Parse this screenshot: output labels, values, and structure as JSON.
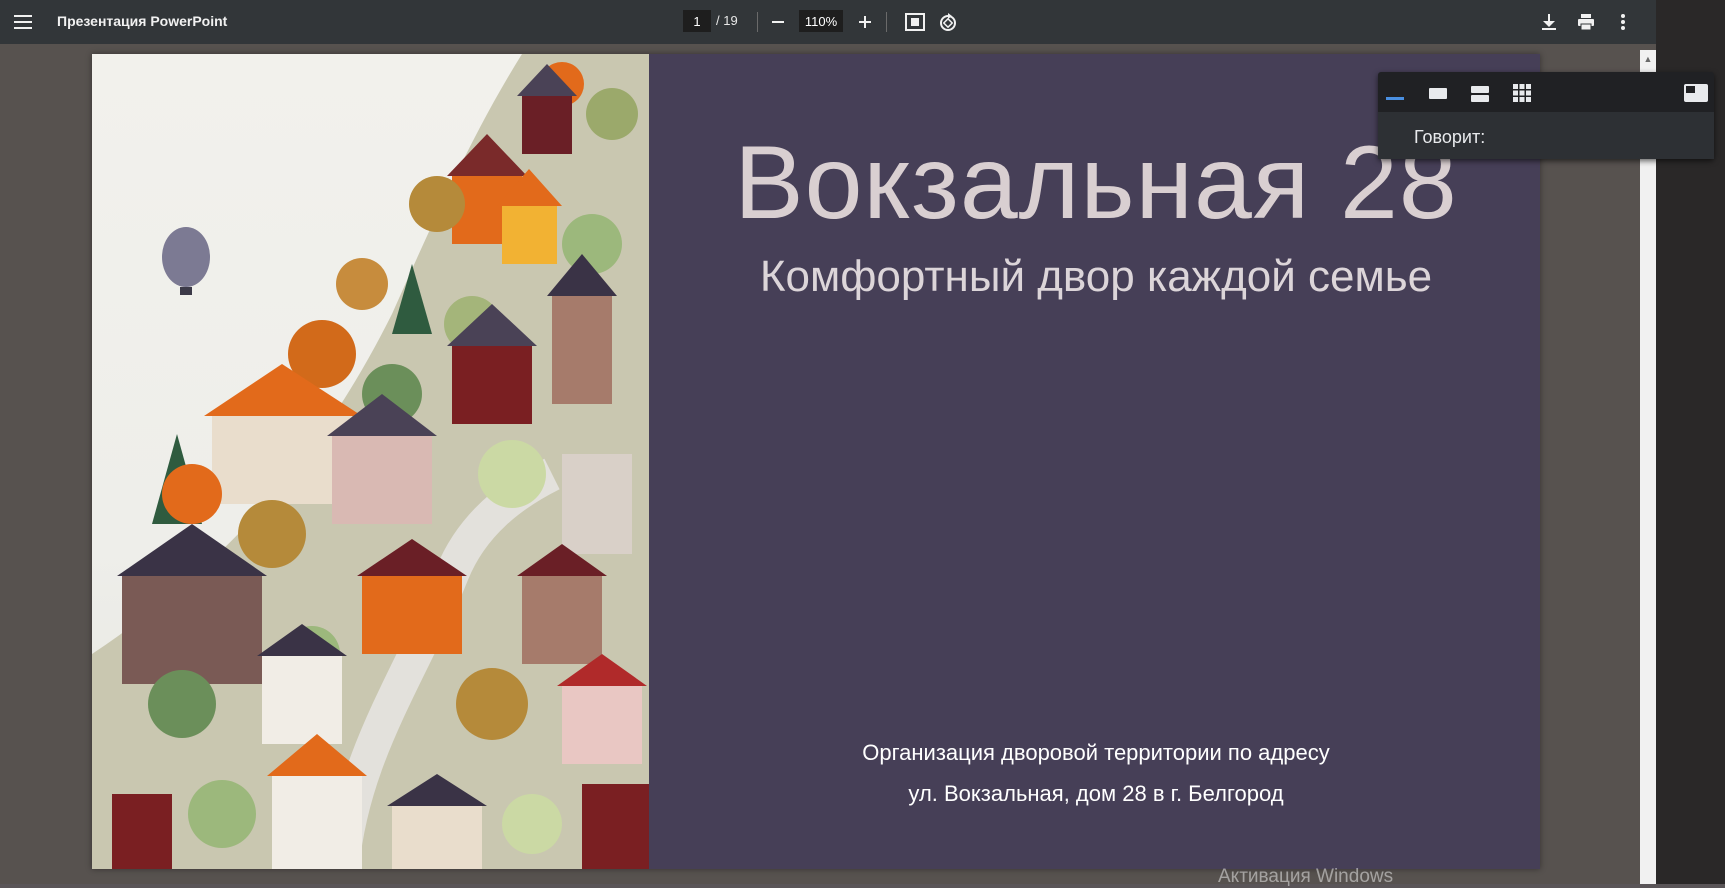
{
  "toolbar": {
    "document_title": "Презентация PowerPoint",
    "current_page": "1",
    "page_total": "/ 19",
    "zoom": "110%"
  },
  "slide": {
    "title": "Вокзальная 28",
    "subtitle": "Комфортный двор каждой семье",
    "line1": "Организация дворовой территории по адресу",
    "line2": "ул. Вокзальная, дом 28 в г. Белгород",
    "background_color": "#463f57"
  },
  "speaker_panel": {
    "label": "Говорит:",
    "active_color": "#4a90e2"
  },
  "watermark": "Активация Windows"
}
